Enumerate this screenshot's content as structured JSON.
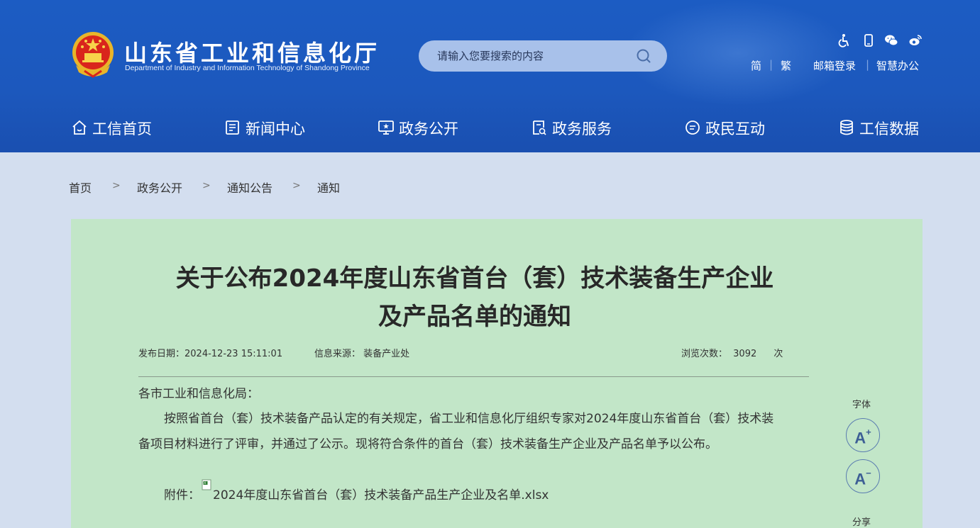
{
  "header": {
    "site_title": "山东省工业和信息化厅",
    "site_subtitle": "Department of Industry and Information Technology of Shandong Province",
    "search_placeholder": "请输入您要搜索的内容",
    "icons": [
      "accessibility-icon",
      "mobile-icon",
      "wechat-icon",
      "weibo-icon"
    ],
    "links": {
      "simplified": "简",
      "traditional": "繁",
      "mail_login": "邮箱登录",
      "smart_office": "智慧办公",
      "separator": "|"
    },
    "colors": {
      "header_bg": "#1c5cc3",
      "search_bg": "#a8c1ea"
    }
  },
  "nav": {
    "items": [
      {
        "label": "工信首页",
        "icon": "home-icon"
      },
      {
        "label": "新闻中心",
        "icon": "document-icon"
      },
      {
        "label": "政务公开",
        "icon": "monitor-icon"
      },
      {
        "label": "政务服务",
        "icon": "service-icon"
      },
      {
        "label": "政民互动",
        "icon": "chat-icon"
      },
      {
        "label": "工信数据",
        "icon": "database-icon"
      }
    ]
  },
  "breadcrumb": {
    "items": [
      "首页",
      "政务公开",
      "通知公告",
      "通知"
    ],
    "separator": ">"
  },
  "article": {
    "title_line1": "关于公布2024年度山东省首台（套）技术装备生产企业",
    "title_line2": "及产品名单的通知",
    "publish_label": "发布日期：",
    "publish_date": "2024-12-23 15:11:01",
    "source_label": "信息来源：",
    "source": "装备产业处",
    "views_label": "浏览次数：",
    "views": "3092",
    "views_unit": "次",
    "salutation": "各市工业和信息化局：",
    "paragraph_line1": "按照省首台（套）技术装备产品认定的有关规定，省工业和信息化厅组织专家对2024年度山东省首台（套）技术装",
    "paragraph_line2": "备项目材料进行了评审，并通过了公示。现将符合条件的首台（套）技术装备生产企业及产品名单予以公布。",
    "attachment_label": "附件：",
    "attachment_name": "2024年度山东省首台（套）技术装备产品生产企业及名单.xlsx",
    "colors": {
      "article_bg": "#c2e6c8"
    }
  },
  "tools": {
    "font_label": "字体",
    "font_increase": "A",
    "font_decrease": "A",
    "plus": "+",
    "minus": "−",
    "share_label": "分享"
  }
}
